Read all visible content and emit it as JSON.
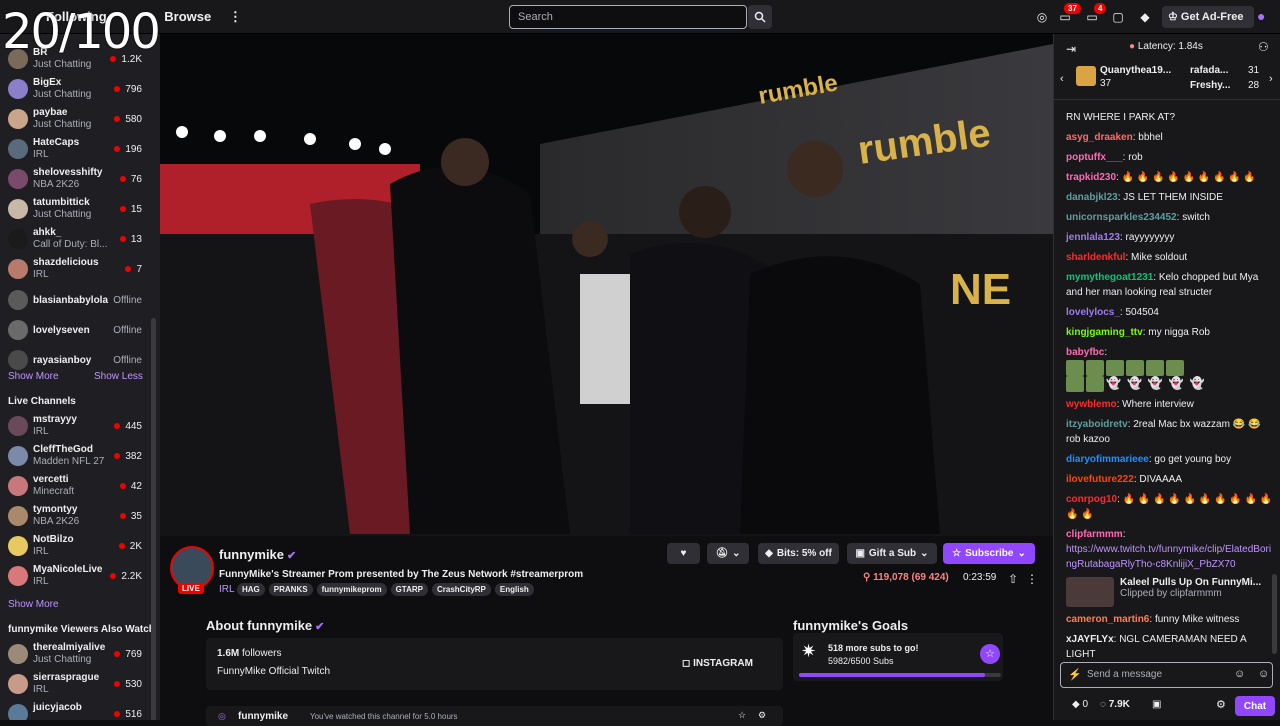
{
  "overlay": {
    "counter": "20/100"
  },
  "topbar": {
    "nav_following": "Following",
    "nav_browse": "Browse",
    "search_placeholder": "Search",
    "badge_inbox": "37",
    "badge_notifications": "4",
    "adfree_label": "Get Ad-Free"
  },
  "sidebar": {
    "followed": [
      {
        "name": "BR",
        "category": "Just Chatting",
        "viewers": "1.2K",
        "color": "#7a6a5a"
      },
      {
        "name": "BigEx",
        "category": "Just Chatting",
        "viewers": "796",
        "color": "#8a7fc8"
      },
      {
        "name": "paybae",
        "category": "Just Chatting",
        "viewers": "580",
        "color": "#c9a58a"
      },
      {
        "name": "HateCaps",
        "category": "IRL",
        "viewers": "196",
        "color": "#5a6a7a"
      },
      {
        "name": "shelovesshifty",
        "category": "NBA 2K26",
        "viewers": "76",
        "color": "#7a4a6a"
      },
      {
        "name": "tatumbittick",
        "category": "Just Chatting",
        "viewers": "15",
        "color": "#c8b8a8"
      },
      {
        "name": "ahkk_",
        "category": "Call of Duty: Bl...",
        "viewers": "13",
        "color": "#1a1a1a"
      },
      {
        "name": "shazdelicious",
        "category": "IRL",
        "viewers": "7",
        "color": "#b87a6a"
      }
    ],
    "offline": [
      {
        "name": "blasianbabylola",
        "status": "Offline",
        "color": "#5a5a5a"
      },
      {
        "name": "lovelyseven",
        "status": "Offline",
        "color": "#6a6a6a"
      },
      {
        "name": "rayasianboy",
        "status": "Offline",
        "color": "#4a4a4a"
      }
    ],
    "show_more": "Show More",
    "show_less": "Show Less",
    "live_header": "Live Channels",
    "live": [
      {
        "name": "mstrayyy",
        "category": "IRL",
        "viewers": "445",
        "color": "#6a4a5a"
      },
      {
        "name": "CleffTheGod",
        "category": "Madden NFL 27",
        "viewers": "382",
        "color": "#7a8aa8"
      },
      {
        "name": "vercetti",
        "category": "Minecraft",
        "viewers": "42",
        "color": "#c8787a"
      },
      {
        "name": "tymontyy",
        "category": "NBA 2K26",
        "viewers": "35",
        "color": "#a88a6a"
      },
      {
        "name": "NotBilzo",
        "category": "IRL",
        "viewers": "2K",
        "color": "#e8c860"
      },
      {
        "name": "MyaNicoleLive",
        "category": "IRL",
        "viewers": "2.2K",
        "color": "#d8787a"
      }
    ],
    "show_more_2": "Show More",
    "also_watch_header": "funnymike Viewers Also Watch",
    "also_watch": [
      {
        "name": "therealmiyalive",
        "category": "Just Chatting",
        "viewers": "769",
        "color": "#9a8a7a"
      },
      {
        "name": "sierrasprague",
        "category": "IRL",
        "viewers": "530",
        "color": "#c89a8a"
      },
      {
        "name": "juicyjacob",
        "category": "",
        "viewers": "516",
        "color": "#5a7a9a"
      }
    ]
  },
  "channel": {
    "name": "funnymike",
    "live_label": "LIVE",
    "title": "FunnyMike's Streamer Prom presented by The Zeus Network #streamerprom",
    "category": "IRL",
    "tags": [
      "HAG",
      "PRANKS",
      "funnymikeprom",
      "GTARP",
      "CrashCityRP",
      "English"
    ],
    "bits_label": "Bits: 5% off",
    "gift_label": "Gift a Sub",
    "subscribe_label": "Subscribe",
    "viewers": "119,078 (69 424)",
    "uptime": "0:23:59"
  },
  "about": {
    "header": "About funnymike",
    "followers_count": "1.6M",
    "followers_label": "followers",
    "description": "FunnyMike Official Twitch",
    "instagram": "INSTAGRAM"
  },
  "goals": {
    "header": "funnymike's Goals",
    "title": "518 more subs to go!",
    "progress_text": "5982/6500 Subs",
    "progress": 0.92
  },
  "bottom": {
    "name": "funnymike",
    "watched": "You've watched this channel for 5.0 hours"
  },
  "chat": {
    "latency": "Latency: 1.84s",
    "pinned": [
      {
        "name": "Quanythea19...",
        "count": "37"
      },
      {
        "name": "rafada...",
        "count": "31"
      },
      {
        "name": "Freshy...",
        "count": "28"
      }
    ],
    "messages": [
      {
        "user": "",
        "color": "#efeff1",
        "text": "RN WHERE I PARK AT?"
      },
      {
        "user": "asyg_draaken",
        "color": "#ff6b6b",
        "text": "bbhel"
      },
      {
        "user": "poptuffx___",
        "color": "#ff69b4",
        "text": "rob"
      },
      {
        "user": "trapkid230",
        "color": "#ff69b4",
        "text": "🔥 🔥 🔥 🔥 🔥 🔥 🔥 🔥 🔥"
      },
      {
        "user": "danabjkl23",
        "color": "#5f9ea0",
        "text": "JS LET THEM INSIDE"
      },
      {
        "user": "unicornsparkles234452",
        "color": "#5f9ea0",
        "text": "switch"
      },
      {
        "user": "jennlala123",
        "color": "#9d7cf0",
        "text": "rayyyyyyyy"
      },
      {
        "user": "sharldenkful",
        "color": "#ff2a2a",
        "text": "Mike soldout"
      },
      {
        "user": "mymythegoat1231",
        "color": "#00c87a",
        "text": "Kelo chopped but Mya and her man looking real structer"
      },
      {
        "user": "lovelylocs_",
        "color": "#9d7cf0",
        "text": "504504"
      },
      {
        "user": "kingjgaming_ttv",
        "color": "#7cfc00",
        "text": "my nigga Rob"
      },
      {
        "user": "babyfbc",
        "color": "#ff69b4",
        "text": ""
      },
      {
        "user": "wywblemo",
        "color": "#ff2a2a",
        "text": "Where interview"
      },
      {
        "user": "itzyaboidretv",
        "color": "#5f9ea0",
        "text": "2real Mac bx wazzam 😂 😂 rob kazoo"
      },
      {
        "user": "diaryofimmarieee",
        "color": "#1e90ff",
        "text": "go get young boy"
      },
      {
        "user": "ilovefuture222",
        "color": "#ff4500",
        "text": "DIVAAAA"
      },
      {
        "user": "conrpog10",
        "color": "#ff2a2a",
        "text": "🔥 🔥 🔥 🔥 🔥 🔥 🔥 🔥 🔥 🔥 🔥 🔥"
      },
      {
        "user": "clipfarmmm",
        "color": "#ff69b4",
        "text": ""
      }
    ],
    "clip_link": "https://www.twitch.tv/funnymike/clip/ElatedBoringRutabagaRlyTho-c8KnlijiX_PbZX70",
    "clip_title": "Kaleel Pulls Up On FunnyMi...",
    "clip_by": "Clipped by clipfarmmm",
    "messages_after": [
      {
        "user": "cameron_martin6",
        "color": "#ff7f50",
        "text": "funny Mike witness"
      },
      {
        "user": "xJAYFLYx",
        "color": "#efeff1",
        "text": "NGL CAMERAMAN NEED A LIGHT"
      }
    ],
    "input_placeholder": "Send a message",
    "points_zero": "0",
    "points": "7.9K",
    "chat_button": "Chat"
  }
}
